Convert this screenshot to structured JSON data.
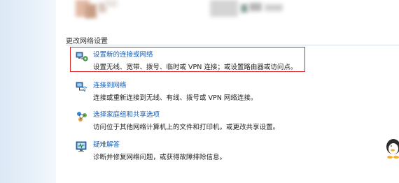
{
  "section": {
    "title": "更改网络设置"
  },
  "items": [
    {
      "icon": "network-setup-icon",
      "link": "设置新的连接或网络",
      "description": "设置无线、宽带、拨号、临时或 VPN 连接；或设置路由器或访问点。",
      "highlighted": true
    },
    {
      "icon": "connect-network-icon",
      "link": "连接到网络",
      "description": "连接或重新连接到无线、有线、拨号或 VPN 网络连接。",
      "highlighted": false
    },
    {
      "icon": "homegroup-sharing-icon",
      "link": "选择家庭组和共享选项",
      "description": "访问位于其他网络计算机上的文件和打印机，或更改共享设置。",
      "highlighted": false
    },
    {
      "icon": "troubleshoot-icon",
      "link": "疑难解答",
      "description": "诊断并修复网络问题，或获得故障排除信息。",
      "highlighted": false
    }
  ],
  "colors": {
    "link": "#1a5fb4",
    "highlight_border": "#e02a2a",
    "left_pane": "#dbe8f5"
  }
}
